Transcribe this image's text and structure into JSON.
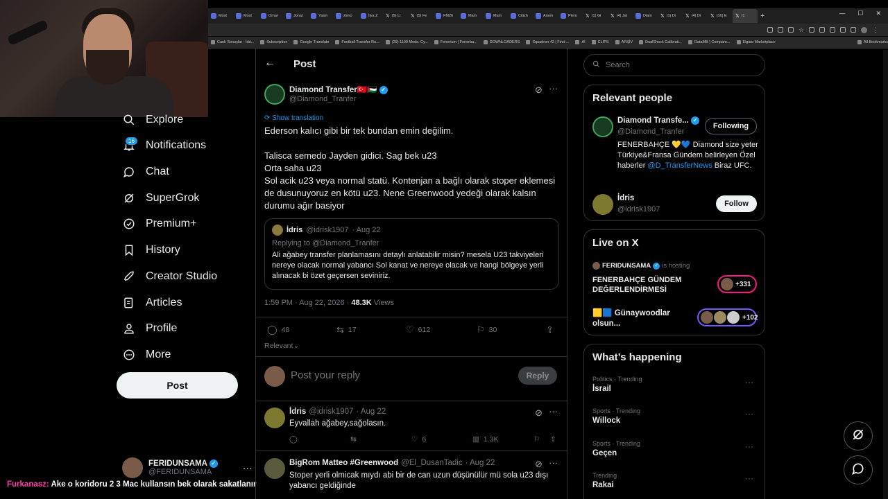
{
  "browser": {
    "tabs": [
      "Most",
      "Most",
      "Omar",
      "Jonat",
      "Yasin",
      "Zeno",
      "İlya Z",
      "(5) Lt",
      "(5) Fe",
      "FM26",
      "Mam",
      "Mam",
      "Citizh",
      "Arsen",
      "Plero",
      "(1) Gi",
      "(4) Jal",
      "Diam",
      "(1) Di",
      "(4) Di",
      "(16) E",
      "(1"
    ],
    "bookmarks": [
      "Canlı Sonuçlar - İdd...",
      "Subscription",
      "Google Translate",
      "Football Transfer Ru...",
      "(29) 1100 Mods. Cy...",
      "Fenerium | Fenerba...",
      "DOWNLOADERS",
      "Squadron 42 | First-...",
      "AI",
      "CLIPS",
      "ARŞİV",
      "DualShock Calibrati...",
      "DataMB | Compare...",
      "Elgato Marketplace",
      "All Bookmarks"
    ]
  },
  "nav": {
    "explore": "Explore",
    "notifications": "Notifications",
    "notifications_badge": "16",
    "chat": "Chat",
    "supergrok": "SuperGrok",
    "premium": "Premium+",
    "history": "History",
    "creator_studio": "Creator Studio",
    "articles": "Articles",
    "profile": "Profile",
    "more": "More",
    "post_button": "Post",
    "account_name": "FERIDUNSAMA",
    "account_handle": "@FERIDUNSAMA"
  },
  "stream_chat": {
    "user": "Furkanasz:",
    "message": "Ake o koridoru 2 3 Mac kullansın bek olarak sakatlanır"
  },
  "post": {
    "header_title": "Post",
    "author_name": "Diamond Transfer🇹🇷🇵🇸",
    "author_handle": "@Diamond_Tranfer",
    "show_translation": "Show translation",
    "line1": "Ederson kalıcı gibi bir tek bundan emin değilim.",
    "line2": "Talisca semedo Jayden gidici. Sag bek u23",
    "line3": "Orta saha u23",
    "line4": "Sol acik u23 veya normal statü. Kontenjan a bağlı olarak stoper eklemesi de dusunuyoruz en kötü u23. Nene Greenwood yedeği olarak kalsın durumu ağır basiyor",
    "timestamp": "1:59 PM · Aug 22, 2026 ·",
    "views_count": "48.3K",
    "views_label": "Views",
    "replies": "48",
    "reposts": "17",
    "likes": "612",
    "bookmarks": "30",
    "sort": "Relevant"
  },
  "quote": {
    "author_name": "İdris",
    "author_handle": "@idrisk1907",
    "date": "· Aug 22",
    "replying_to": "Replying to @Diamond_Tranfer",
    "text": "Ali ağabey transfer planlamasını detaylı anlatabilir misin? mesela U23 takviyeleri nereye olacak normal yabancı Sol kanat ve nereye olacak ve hangi bölgeye yerli alınacak bi özet geçersen seviniriz."
  },
  "composer": {
    "placeholder": "Post your reply",
    "reply_button": "Reply"
  },
  "replies": [
    {
      "name": "İdris",
      "handle": "@idrisk1907",
      "date": "· Aug 22",
      "text": "Eyvallah ağabey,sağolasın.",
      "likes": "6",
      "views": "1.3K"
    },
    {
      "name": "BigRom Matteo #Greenwood",
      "handle": "@El_DusanTadic",
      "date": "· Aug 22",
      "text": "Stoper yerli olmicak mıydı abi bir de can uzun düşünülür mü sola u23 dışı yabancı geldiğinde"
    }
  ],
  "sidebar": {
    "search_placeholder": "Search",
    "relevant_title": "Relevant people",
    "person1_name": "Diamond Transfe...",
    "person1_handle": "@Diamond_Tranfer",
    "person1_bio_a": "FENERBAHÇE 💛💙 Diamond size yeter Türkiye&Fransa Gündem belirleyen Özel haberler",
    "person1_bio_link": "@D_TransferNews",
    "person1_bio_b": "Biraz UFC.",
    "person1_button": "Following",
    "person2_name": "İdris",
    "person2_handle": "@idrisk1907",
    "person2_button": "Follow",
    "live_title": "Live on X",
    "live1_host": "FERIDUNSAMA",
    "live1_hosting": "is hosting",
    "live1_title": "FENERBAHÇE GÜNDEM DEĞERLENDİRMESİ",
    "live1_count": "+331",
    "live2_title": "🟨🟦 Günaywoodlar olsun...",
    "live2_count": "+102",
    "happening_title": "What’s happening",
    "trends": [
      {
        "category": "Politics · Trending",
        "name": "İsrail"
      },
      {
        "category": "Sports · Trending",
        "name": "Willock"
      },
      {
        "category": "Sports · Trending",
        "name": "Geçen"
      },
      {
        "category": "Trending",
        "name": "Rakai"
      }
    ]
  },
  "colors": {
    "accent": "#1d9bf0",
    "background": "#000000",
    "border": "#2f3336",
    "muted": "#71767b",
    "live_ring1": "#f91880",
    "live_ring2": "#7856ff",
    "chat_user": "#ff3da6"
  }
}
